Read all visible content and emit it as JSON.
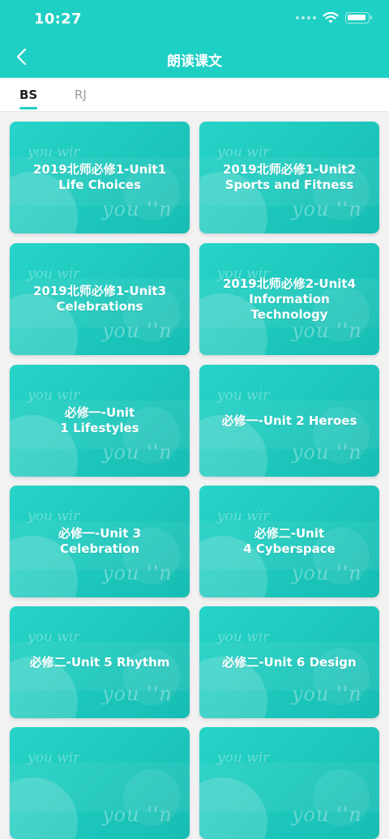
{
  "status_bar": {
    "time": "10:27"
  },
  "header": {
    "title": "朗读课文"
  },
  "tabs": [
    {
      "label": "BS",
      "active": true
    },
    {
      "label": "RJ",
      "active": false
    }
  ],
  "card_decoration": {
    "text_top": "you wir",
    "text_bottom": "you  ''n"
  },
  "cards": [
    {
      "title": "2019北师必修1-Unit1\nLife Choices"
    },
    {
      "title": "2019北师必修1-Unit2\nSports and Fitness"
    },
    {
      "title": "2019北师必修1-Unit3\nCelebrations"
    },
    {
      "title": "2019北师必修2-Unit4\nInformation\nTechnology"
    },
    {
      "title": "必修一-Unit\n1 Lifestyles"
    },
    {
      "title": "必修一-Unit 2 Heroes"
    },
    {
      "title": "必修一-Unit 3\nCelebration"
    },
    {
      "title": "必修二-Unit\n4 Cyberspace"
    },
    {
      "title": "必修二-Unit 5 Rhythm"
    },
    {
      "title": "必修二-Unit 6 Design"
    },
    {
      "title": ""
    },
    {
      "title": ""
    }
  ],
  "colors": {
    "accent": "#1ecfc4",
    "background": "#f2f2f2",
    "tab_active": "#222222",
    "tab_inactive": "#9a9a9a"
  },
  "icons": {
    "back": "chevron-left-icon",
    "wifi": "wifi-icon",
    "battery": "battery-icon",
    "signal": "signal-icon"
  }
}
